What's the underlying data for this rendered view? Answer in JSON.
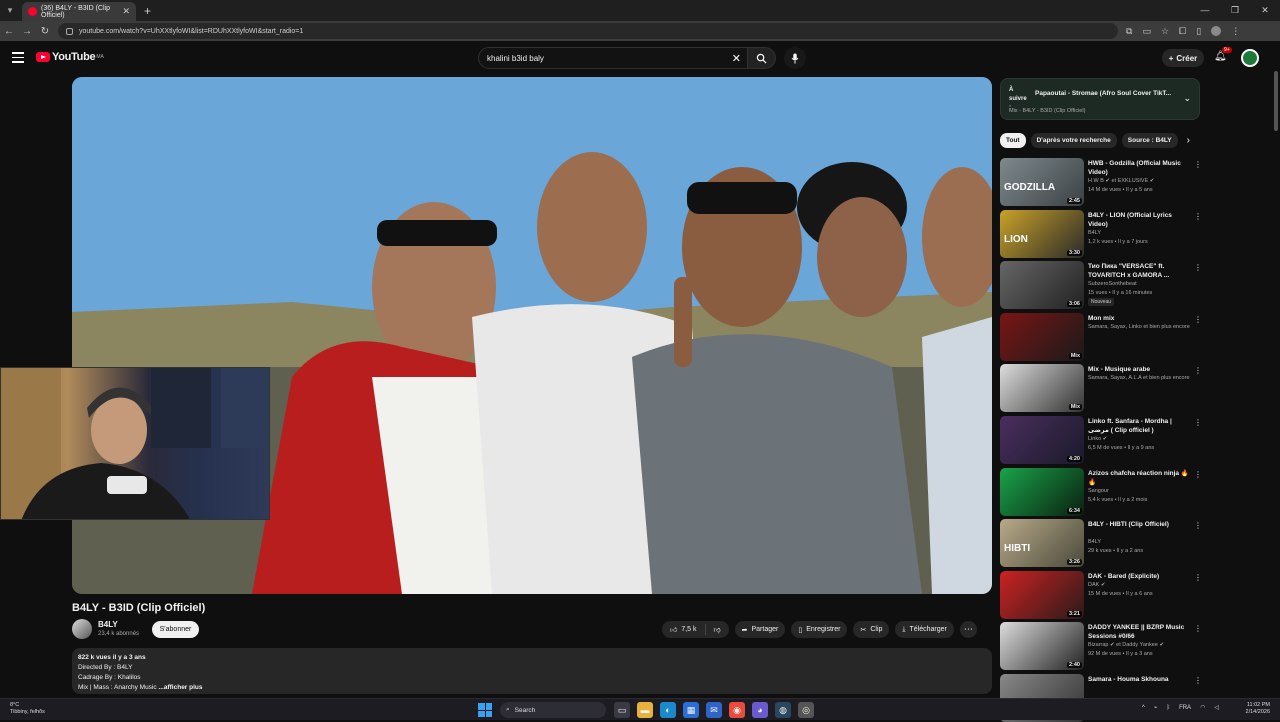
{
  "browser": {
    "tab_title": "(36) B4LY - B3ID (Clip Officiel)",
    "url": "youtube.com/watch?v=UhXXtlyfoWI&list=RDUhXXtlyfoWI&start_radio=1"
  },
  "youtube": {
    "logo_text": "YouTube",
    "logo_region": "MA",
    "search_query": "khalini b3id  baly",
    "create_label": "Créer",
    "notif_count": "9+"
  },
  "video": {
    "title": "B4LY - B3ID (Clip Officiel)",
    "channel": "B4LY",
    "subscribers": "23,4 k abonnés",
    "subscribe_label": "S'abonner",
    "likes": "7,5 k",
    "share_label": "Partager",
    "save_label": "Enregistrer",
    "clip_label": "Clip",
    "download_label": "Télécharger",
    "description": {
      "stats": "822 k vues  il y a 3 ans",
      "line1": "Directed By : B4LY",
      "line2": "Cadrage By : Khalilos",
      "line3": "Mix | Mass : Anarchy Music",
      "more": "...afficher plus"
    }
  },
  "sidebar": {
    "up_next": {
      "label": "À suivre :",
      "title": "Papaoutai - Stromae (Afro Soul Cover TikT...",
      "sub": "Mix - B4LY - B3ID (Clip Officiel)"
    },
    "chips": [
      "Tout",
      "D'après votre recherche",
      "Source : B4LY"
    ],
    "recs": [
      {
        "title": "HWB - Godzilla (Official Music Video)",
        "channel": "H W B ✔ et EXKLUSIVE ✔",
        "views": "14 M de vues • Il y a 5 ans",
        "duration": "2:45",
        "colors": [
          "#7f8a8e",
          "#3b4144"
        ],
        "overlay": "GODZILLA"
      },
      {
        "title": "B4LY - LION (Official Lyrics Video)",
        "channel": "B4LY",
        "views": "1,2 k vues • Il y a 7 jours",
        "duration": "3:30",
        "colors": [
          "#c9a227",
          "#2a2a2a"
        ],
        "overlay": "LION"
      },
      {
        "title": "Тио Пика \"VERSACE\" ft. TOVARITCH x GAMORA ...",
        "channel": "SubzeroSonthebeat",
        "views": "15 vues • Il y a 16 minutes",
        "duration": "3:06",
        "colors": [
          "#666",
          "#222"
        ],
        "overlay": "",
        "badge": "Nouveau"
      },
      {
        "title": "Mon mix",
        "channel": "Samara, Sayax, Linko et bien plus encore",
        "views": "",
        "duration": "Mix",
        "colors": [
          "#7a1515",
          "#1a1a1a"
        ],
        "overlay": ""
      },
      {
        "title": "Mix - Musique arabe",
        "channel": "Samara, Sayax, A.L.A et bien plus encore",
        "views": "",
        "duration": "Mix",
        "colors": [
          "#ddd",
          "#333"
        ],
        "overlay": ""
      },
      {
        "title": "Linko ft. Sanfara - Mordha | مرضى ( Clip officiel )",
        "channel": "Linko ✔",
        "views": "6,5 M de vues • Il y a 9 ans",
        "duration": "4:20",
        "colors": [
          "#4a2e5e",
          "#1a1a2a"
        ],
        "overlay": ""
      },
      {
        "title": "Azizos chafcha réaction ninja 🔥🔥",
        "channel": "Sangour",
        "views": "5,4 k vues • Il y a 2 mois",
        "duration": "6:34",
        "colors": [
          "#1aa34a",
          "#0a2010"
        ],
        "overlay": ""
      },
      {
        "title": "B4LY - HIBTI (Clip Officiel)",
        "channel": "B4LY",
        "views": "29 k vues • Il y a 2 ans",
        "duration": "3:26",
        "colors": [
          "#b8a98a",
          "#4a4a3a"
        ],
        "overlay": "HIBTI"
      },
      {
        "title": "DAK - Bared (Explicite)",
        "channel": "DAK ✔",
        "views": "15 M de vues • Il y a 6 ans",
        "duration": "3:21",
        "colors": [
          "#c22",
          "#2a1a1a"
        ],
        "overlay": ""
      },
      {
        "title": "DADDY YANKEE || BZRP Music Sessions #0/66",
        "channel": "Bizarrap ✔ et Daddy Yankee ✔",
        "views": "92 M de vues • Il y a 3 ans",
        "duration": "2:40",
        "colors": [
          "#ddd",
          "#222"
        ],
        "overlay": ""
      },
      {
        "title": "Samara - Houma Skhouna",
        "channel": "",
        "views": "",
        "duration": "",
        "colors": [
          "#888",
          "#333"
        ],
        "overlay": ""
      }
    ]
  },
  "taskbar": {
    "weather_temp": "8°C",
    "weather_loc": "Tibbiny, felhős",
    "search": "Search",
    "lang": "FRA",
    "time": "11:02 PM",
    "date": "2/14/2026"
  }
}
